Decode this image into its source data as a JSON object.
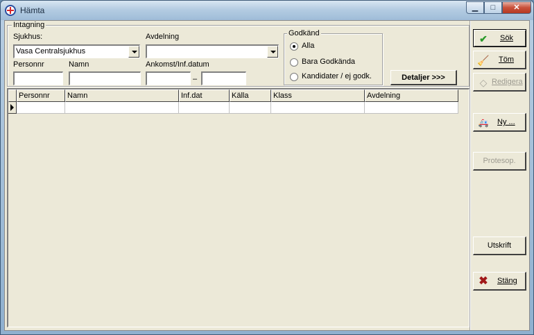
{
  "window": {
    "title": "Hämta"
  },
  "intagning": {
    "legend": "Intagning",
    "sjukhus_label": "Sjukhus:",
    "sjukhus_value": "Vasa Centralsjukhus",
    "avdelning_label": "Avdelning",
    "avdelning_value": "",
    "personnr_label": "Personnr",
    "personnr_value": "",
    "namn_label": "Namn",
    "namn_value": "",
    "ankomst_label": "Ankomst/Inf.datum",
    "date_from": "",
    "date_to": "",
    "date_separator": "–"
  },
  "godkand": {
    "legend": "Godkänd",
    "options": [
      {
        "label": "Alla",
        "checked": true
      },
      {
        "label": "Bara Godkända",
        "checked": false
      },
      {
        "label": "Kandidater / ej godk.",
        "checked": false
      }
    ]
  },
  "detaljer_label": "Detaljer >>>",
  "grid": {
    "columns": [
      "Personnr",
      "Namn",
      "Inf.dat",
      "Källa",
      "Klass",
      "Avdelning"
    ],
    "rows": []
  },
  "buttons": {
    "sok": {
      "label": "Sök",
      "icon": "check-icon",
      "enabled": true
    },
    "tom": {
      "label": "Töm",
      "icon": "broom-icon",
      "enabled": true
    },
    "redigera": {
      "label": "Redigera",
      "icon": "eraser-icon",
      "enabled": false
    },
    "ny": {
      "label": "Ny ...",
      "icon": "ambulance-icon",
      "enabled": true
    },
    "protesop": {
      "label": "Protesop.",
      "enabled": false
    },
    "utskrift": {
      "label": "Utskrift",
      "enabled": true
    },
    "stang": {
      "label": "Stäng",
      "icon": "x-icon",
      "enabled": true
    }
  },
  "colors": {
    "check": "#2a9a2a",
    "close_x": "#a01818",
    "accent_red": "#d8262a"
  }
}
